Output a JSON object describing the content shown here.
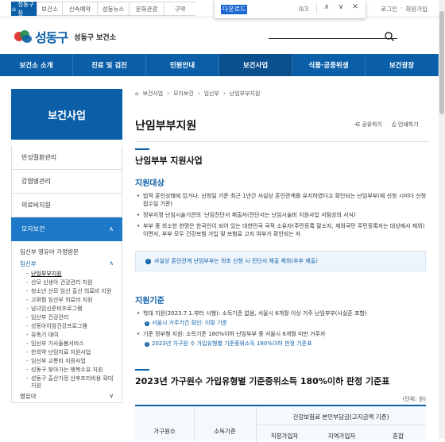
{
  "topbar": {
    "tabs": [
      {
        "label": "성동구청",
        "active": true,
        "width": 32
      },
      {
        "label": "보건소",
        "active": false,
        "width": 32
      },
      {
        "label": "신속예약",
        "active": false,
        "width": 44
      },
      {
        "label": "성동뉴스",
        "active": false,
        "width": 40
      },
      {
        "label": "문화관광",
        "active": false,
        "width": 44
      },
      {
        "label": "구약",
        "active": false,
        "width": 40
      }
    ],
    "links": [
      "로그인",
      "·",
      "회원가입"
    ]
  },
  "findbar": {
    "query": "다운로드",
    "count": "0/3",
    "up": "∧",
    "down": "∨",
    "close": "✕"
  },
  "header": {
    "brand": "성동구",
    "sub": "성동구 보건소"
  },
  "gnb": [
    "보건소 소개",
    "진료 및 검진",
    "민원안내",
    "보건사업",
    "식품·공중위생",
    "보건광장"
  ],
  "gnb_active": 3,
  "side": {
    "title": "보건사업",
    "items": [
      "만성질환관리",
      "감염병관리",
      "의료비지원"
    ],
    "active": "모자보건",
    "l2_1": "임신부 영유아 가정방문",
    "l2_2": "임신부",
    "l3": [
      "난임부부지원",
      "산모 신생아 건강관리 지원",
      "청소년 산모 임신 출산 의료비 지원",
      "고위험 임산부 의료비 지원",
      "남녀임신준비프로그램",
      "임산부 건강관리",
      "성동아이맘건강프로그램",
      "유축기 대여",
      "임신부 가사돌봄서비스",
      "한의약 난임치료 지원사업",
      "임신부 교통비 지원사업",
      "성동구 찾아가는 행복수유 지원",
      "성동구 출산가정 산후조리비용 확대지원"
    ],
    "l2_3": "영유아"
  },
  "main": {
    "crumb": [
      "보건사업",
      "모자보건",
      "임신부",
      "난임부부지원"
    ],
    "title": "난임부부지원",
    "share": "공유하기",
    "print": "인쇄하기",
    "h2": "난임부부 지원사업",
    "h3a": "지원대상",
    "bul1": "법적 혼인상태에 있거나, 신청일 기준 최근 1년간 사실상 혼인관계를 유지하였다고 확인되는 난임부부(예 신청 시미다 신청 접수일 기준)",
    "bul2": "정부지정 난임시술기관의 '난임진단서 제출자(진단서는 난임시술비 지원사업 서점상의 서식)",
    "bul3": "부부 중 최소한 한명은 한국인이 되어 있는 대한민국 국적 소유자(주민등록 말소자, 재외국민 주민등록자는 대상에서 제외)이면서, 부부 모두 건강보험 가입 및 보험료 고지 여부가 확인되는 자",
    "note": "사실상 혼인관계 난임부부는 최초 신청 시 진단서 제출 제외(추후 제출)",
    "h3b": "지원기준",
    "bul4": "학대 지원(2023.7.1.부터 시행): 소득기준 없음, 서울시 6개월 이상 거주 난임부부(사실혼 포함)",
    "link1": "서울시 거주기간 확인: 이렇 기준",
    "bul5": "기준 정부형 지원: 소득기준 180%이하 난임부부 중 서울시 6개월 미만 거주자",
    "link2": "2023년 가구원 수 가입유형별 기준중위소득 180%이하 판정 기준표",
    "table_title": "2023년 가구원수 가입유형별 기준중위소득 180%이하 판정 기준표",
    "unit": "(단위: 원)",
    "th": [
      "가구원수",
      "소득기준",
      "건강보험료 본인부담금(고지금액 기준)",
      "직장가입자",
      "지역가입자",
      "혼합"
    ]
  }
}
